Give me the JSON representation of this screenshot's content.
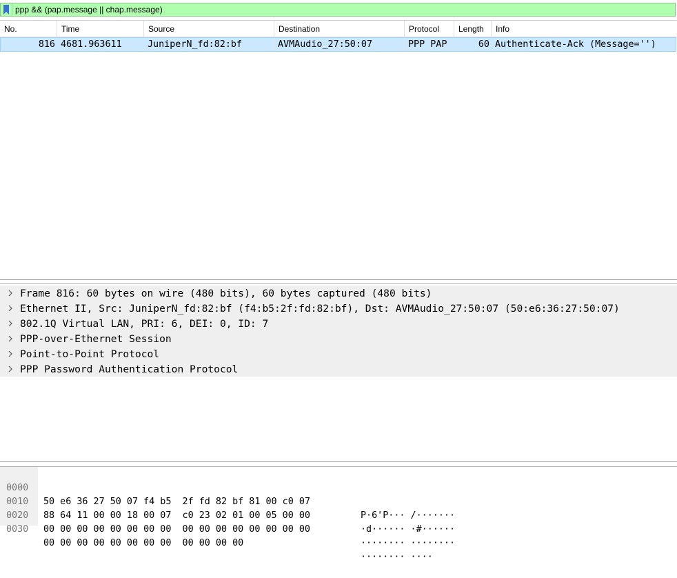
{
  "filter": {
    "text": "ppp && (pap.message || chap.message)",
    "bookmark_icon": "bookmark-icon",
    "background": "#afffaf"
  },
  "packet_list": {
    "columns": [
      "No.",
      "Time",
      "Source",
      "Destination",
      "Protocol",
      "Length",
      "Info"
    ],
    "rows": [
      {
        "no": "816",
        "time": "4681.963611",
        "source": "JuniperN_fd:82:bf",
        "destination": "AVMAudio_27:50:07",
        "protocol": "PPP PAP",
        "length": "60",
        "info": "Authenticate-Ack (Message='')"
      }
    ],
    "selected_row_color": "#cce8ff"
  },
  "details": {
    "items": [
      "Frame 816: 60 bytes on wire (480 bits), 60 bytes captured (480 bits)",
      "Ethernet II, Src: JuniperN_fd:82:bf (f4:b5:2f:fd:82:bf), Dst: AVMAudio_27:50:07 (50:e6:36:27:50:07)",
      "802.1Q Virtual LAN, PRI: 6, DEI: 0, ID: 7",
      "PPP-over-Ethernet Session",
      "Point-to-Point Protocol",
      "PPP Password Authentication Protocol"
    ]
  },
  "hex": {
    "lines": [
      {
        "offset": "0000",
        "bytes": "50 e6 36 27 50 07 f4 b5  2f fd 82 bf 81 00 c0 07",
        "ascii": "P·6'P··· /·······"
      },
      {
        "offset": "0010",
        "bytes": "88 64 11 00 00 18 00 07  c0 23 02 01 00 05 00 00",
        "ascii": "·d······ ·#······"
      },
      {
        "offset": "0020",
        "bytes": "00 00 00 00 00 00 00 00  00 00 00 00 00 00 00 00",
        "ascii": "········ ········"
      },
      {
        "offset": "0030",
        "bytes": "00 00 00 00 00 00 00 00  00 00 00 00",
        "ascii": "········ ····"
      }
    ]
  }
}
